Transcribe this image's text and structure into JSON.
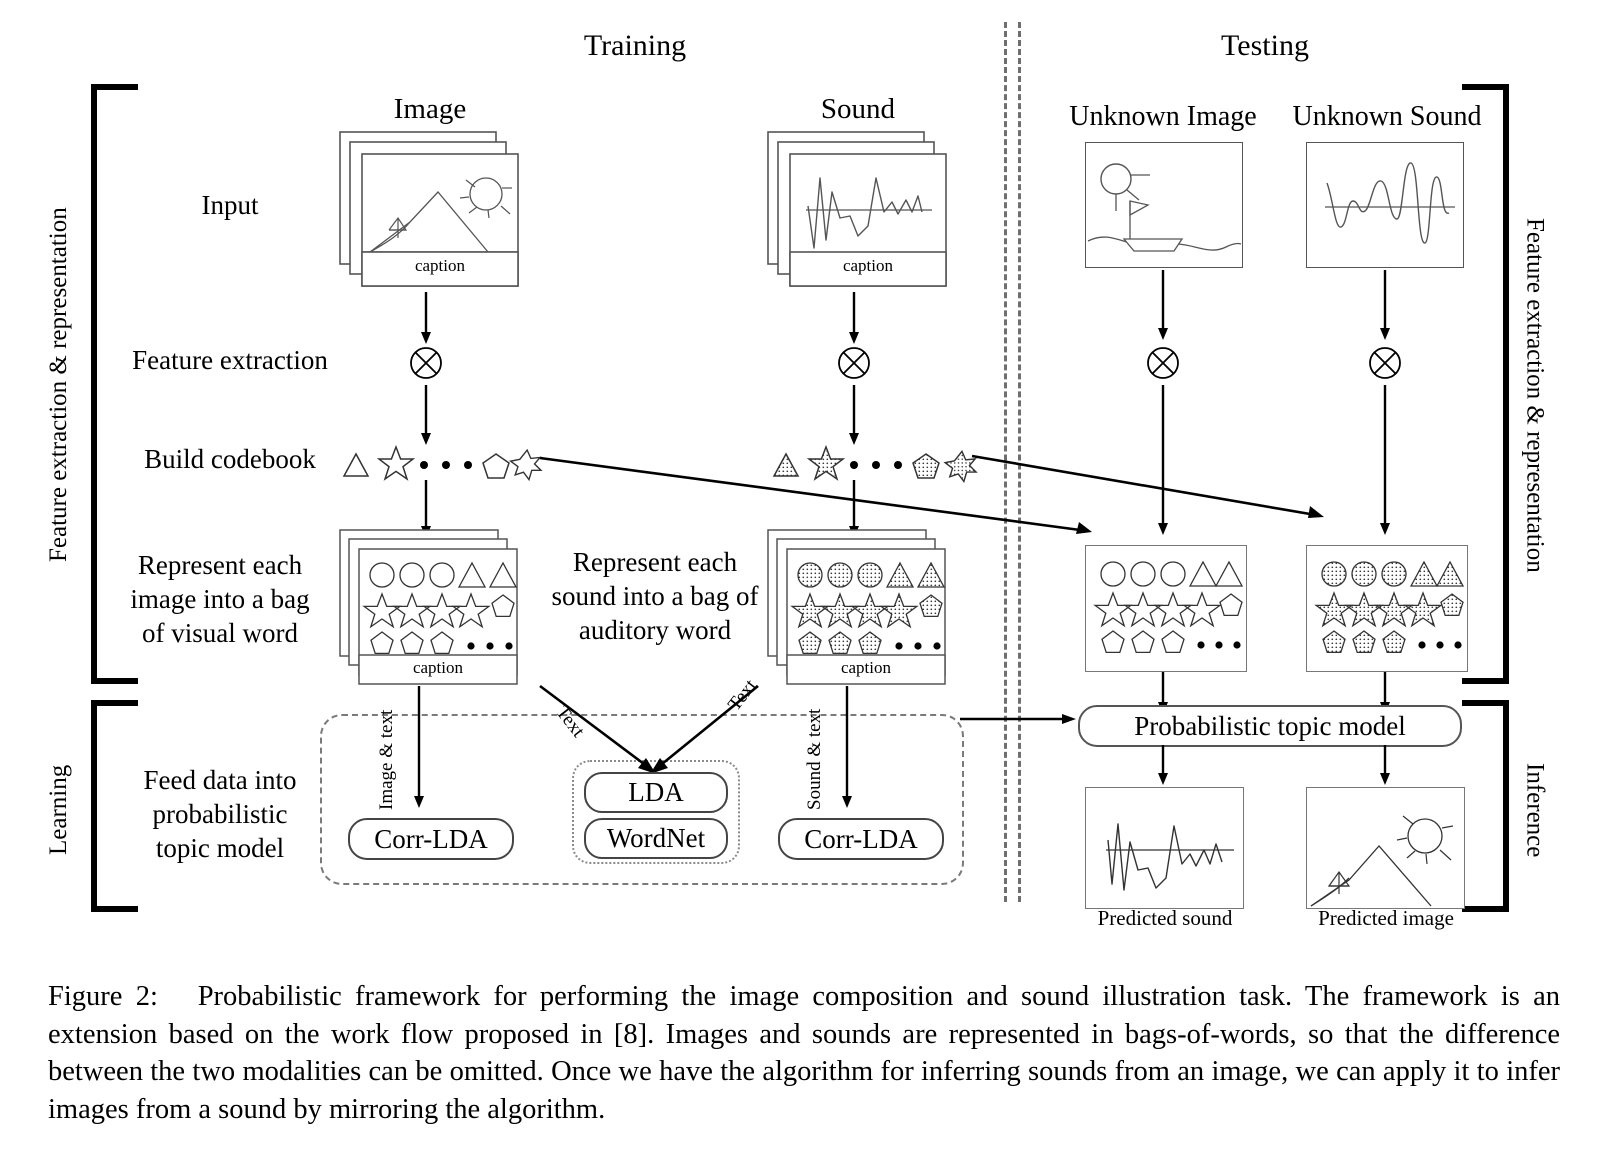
{
  "figure": {
    "headers": {
      "training": "Training",
      "testing": "Testing"
    },
    "side_labels": {
      "left_top": "Feature extraction & representation",
      "left_bottom": "Learning",
      "right_top": "Feature extraction & representation",
      "right_bottom": "Inference"
    },
    "row_labels": [
      "Input",
      "Feature extraction",
      "Build codebook",
      "Represent each image into a bag of visual word",
      "Feed data into probabilistic topic model"
    ],
    "row_label_lines": {
      "input": "Input",
      "feature_extraction": "Feature extraction",
      "build_codebook": "Build codebook",
      "represent_image": [
        "Represent each",
        "image into a bag",
        "of visual word"
      ],
      "represent_sound": [
        "Represent each",
        "sound into a bag of",
        "auditory word"
      ],
      "feed_data": [
        "Feed data into",
        "probabilistic",
        "topic model"
      ]
    },
    "columns": {
      "image": "Image",
      "sound": "Sound",
      "unknown_image": "Unknown Image",
      "unknown_sound": "Unknown Sound"
    },
    "caption_label": "caption",
    "arrow_labels": {
      "image_text": "Image & text",
      "sound_text": "Sound & text",
      "text_left": "Text",
      "text_right": "Text"
    },
    "boxes": {
      "corr_lda_left": "Corr-LDA",
      "corr_lda_right": "Corr-LDA",
      "lda": "LDA",
      "wordnet": "WordNet",
      "topic_model": "Probabilistic topic model"
    },
    "outputs": {
      "predicted_sound": "Predicted sound",
      "predicted_image": "Predicted image"
    },
    "icons": {
      "feature_extraction": "circled-times-icon",
      "codebook_ellipsis": "ellipsis-dots-icon"
    },
    "colors": {
      "ink": "#000000",
      "thin_stroke": "#555555",
      "dashed": "#777777",
      "background": "#ffffff"
    },
    "caption": {
      "number": "Figure 2:",
      "text": "Probabilistic framework for performing the image composition and sound illustration task.  The framework is an extension based on the work flow proposed in [8].  Images and sounds are represented in bags-of-words, so that the difference between the two modalities can be omitted. Once we have the algorithm for inferring sounds from an image, we can apply it to infer images from a sound by mirroring the algorithm."
    }
  }
}
